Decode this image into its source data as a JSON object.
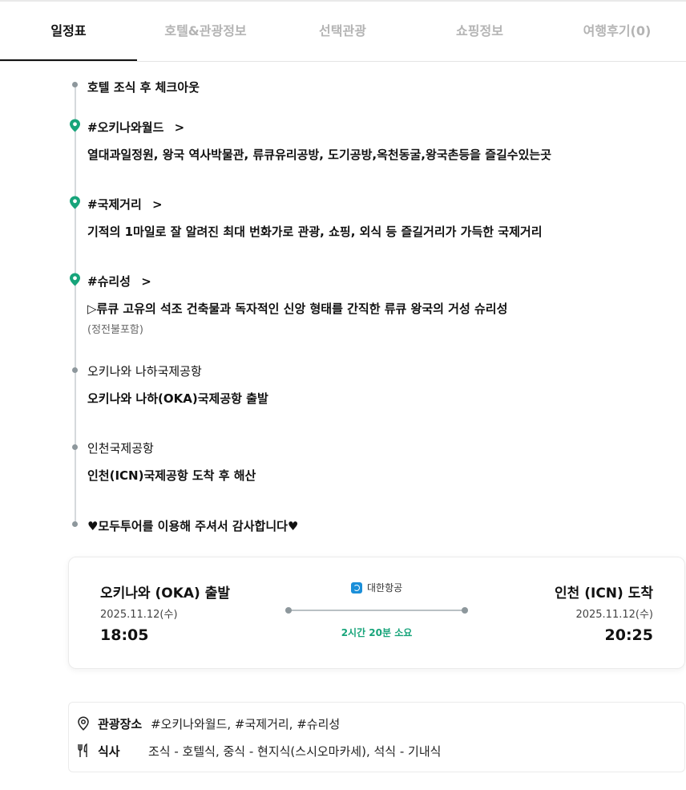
{
  "tabs": [
    {
      "label": "일정표",
      "active": true
    },
    {
      "label": "호텔&관광정보",
      "active": false
    },
    {
      "label": "선택관광",
      "active": false
    },
    {
      "label": "쇼핑정보",
      "active": false
    },
    {
      "label": "여행후기(0)",
      "active": false
    }
  ],
  "timeline": {
    "checkout": "호텔 조식 후 체크아웃",
    "okinawa_world": {
      "title": "#오키나와월드",
      "chevron": ">",
      "desc": "열대과일정원, 왕국 역사박물관, 류큐유리공방, 도기공방,옥천동굴,왕국촌등을 즐길수있는곳"
    },
    "kokusai": {
      "title": "#국제거리",
      "chevron": ">",
      "desc": "기적의 1마일로 잘 알려진 최대 번화가로 관광, 쇼핑, 외식 등 즐길거리가 가득한 국제거리"
    },
    "shurijo": {
      "title": "#슈리성",
      "chevron": ">",
      "desc": "▷류큐 고유의 석조 건축물과 독자적인 신앙 형태를 간직한 류큐 왕국의 거성 슈리성",
      "note": "(정전불포함)"
    },
    "naha_airport": {
      "title": "오키나와 나하국제공항",
      "desc": "오키나와 나하(OKA)국제공항 출발"
    },
    "incheon_airport": {
      "title": "인천국제공항",
      "desc": "인천(ICN)국제공항 도착 후 해산"
    },
    "thanks": "♥모두투어를 이용해 주셔서 감사합니다♥"
  },
  "flight": {
    "airline": "대한항공",
    "airline_icon": "korean-air-logo-icon",
    "departure": {
      "city": "오키나와 (OKA) 출발",
      "date": "2025.11.12(수)",
      "time": "18:05"
    },
    "arrival": {
      "city": "인천 (ICN) 도착",
      "date": "2025.11.12(수)",
      "time": "20:25"
    },
    "duration": "2시간 20분 소요",
    "duration_color": "#17a47a"
  },
  "info": {
    "sightseeing": {
      "icon": "location-pin-icon",
      "label": "관광장소",
      "value": "#오키나와월드, #국제거리, #슈리성"
    },
    "meals": {
      "icon": "fork-knife-icon",
      "label": "식사",
      "value": "조식 - 호텔식, 중식 - 현지식(스시오마카세), 석식 - 기내식"
    }
  },
  "colors": {
    "pin": "#17a47a",
    "timeline_line": "#d5d9dc",
    "timeline_dot": "#8d979c",
    "tab_inactive": "#b4b4b4"
  }
}
